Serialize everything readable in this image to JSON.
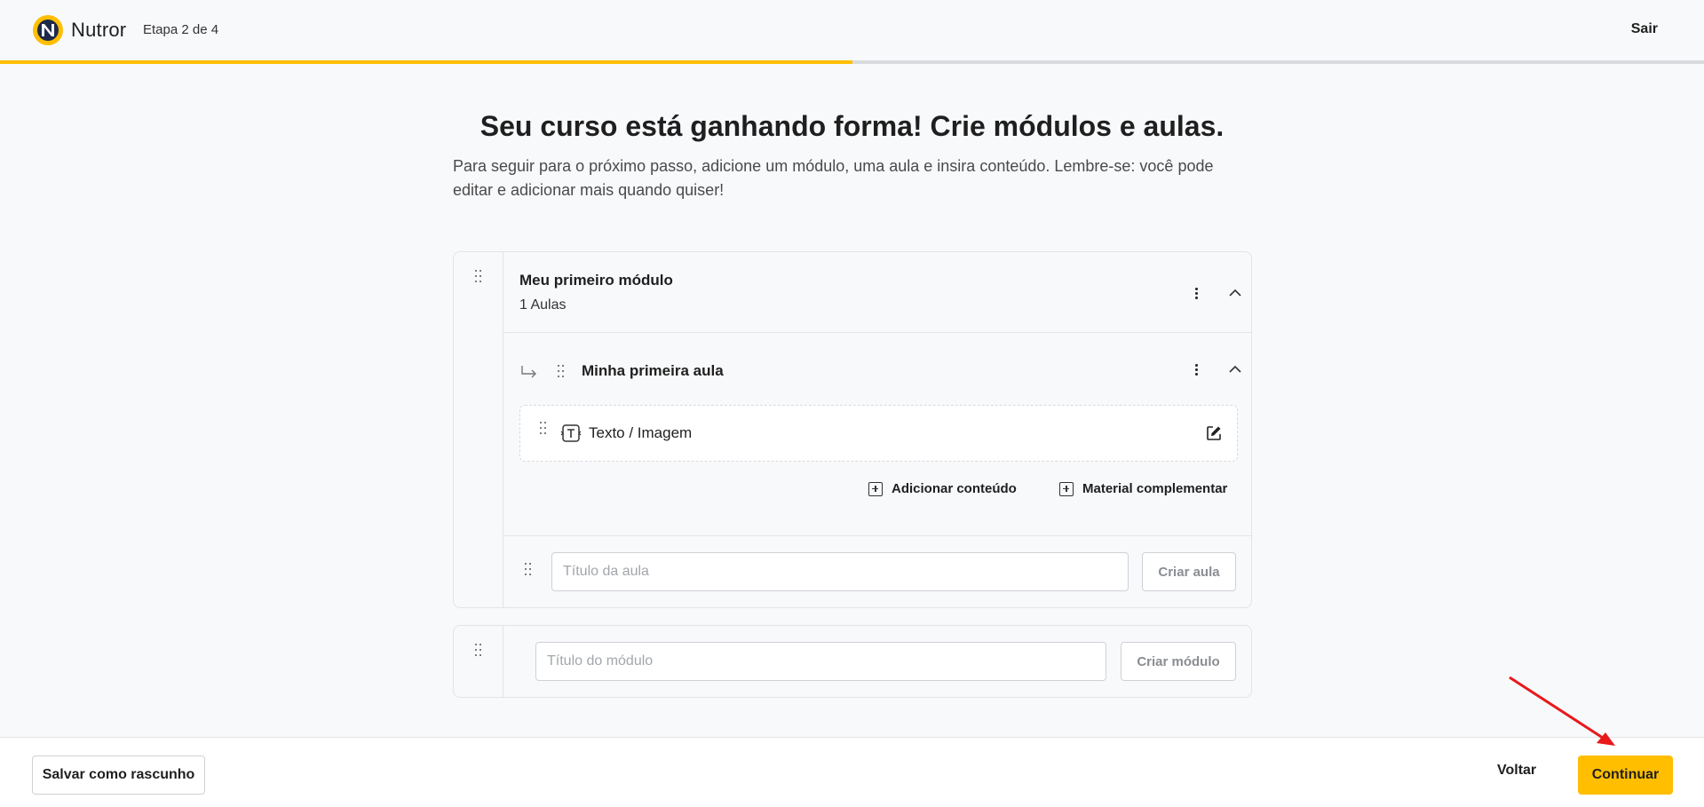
{
  "header": {
    "brand": "Nutror",
    "step": "Etapa 2 de 4",
    "exit_label": "Sair",
    "progress_fraction": 0.5
  },
  "page": {
    "title": "Seu curso está ganhando forma! Crie módulos e aulas.",
    "subtitle": "Para seguir para o próximo passo, adicione um módulo, uma aula e insira conteúdo. Lembre-se: você pode editar e adicionar mais quando quiser!"
  },
  "module": {
    "title": "Meu primeiro módulo",
    "count": "1 Aulas",
    "lesson": {
      "title": "Minha primeira aula",
      "content_item": "Texto / Imagem",
      "add_content_label": "Adicionar conteúdo",
      "supplementary_label": "Material complementar"
    },
    "new_lesson": {
      "placeholder": "Título da aula",
      "button": "Criar aula"
    }
  },
  "new_module": {
    "placeholder": "Título do módulo",
    "button": "Criar módulo"
  },
  "footer": {
    "draft_label": "Salvar como rascunho",
    "back_label": "Voltar",
    "continue_label": "Continuar"
  },
  "colors": {
    "accent": "#ffbe00",
    "annotation": "#e8191b"
  },
  "icons": [
    "nutror-logo-icon",
    "drag-handle-icon",
    "kebab-menu-icon",
    "chevron-up-icon",
    "subdirectory-arrow-icon",
    "text-image-icon",
    "edit-icon",
    "plus-square-icon"
  ]
}
